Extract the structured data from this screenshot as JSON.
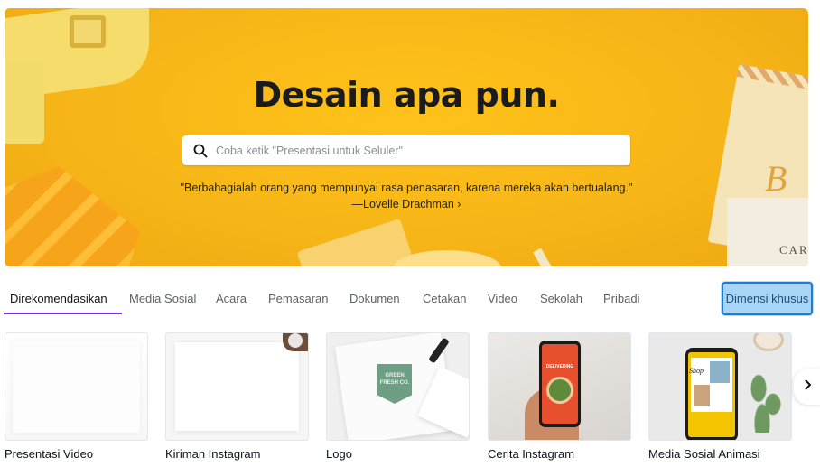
{
  "hero": {
    "title": "Desain apa pun.",
    "search_placeholder": "Coba ketik \"Presentasi untuk Seluler\"",
    "quote": "\"Berbahagialah orang yang mempunyai rasa penasaran, karena mereka akan bertualang.\"",
    "quote_author": "—Lovelle Drachman ›",
    "decoration_text": {
      "cart": "CART",
      "script": "B"
    }
  },
  "tabs": [
    {
      "label": "Direkomendasikan",
      "active": true
    },
    {
      "label": "Media Sosial"
    },
    {
      "label": "Acara"
    },
    {
      "label": "Pemasaran"
    },
    {
      "label": "Dokumen"
    },
    {
      "label": "Cetakan"
    },
    {
      "label": "Video"
    },
    {
      "label": "Sekolah"
    },
    {
      "label": "Pribadi"
    }
  ],
  "custom_size_button": "Dimensi khusus",
  "cards": [
    {
      "label": "Presentasi Video"
    },
    {
      "label": "Kiriman Instagram"
    },
    {
      "label": "Logo",
      "thumb_text": "GREEN FRESH CO."
    },
    {
      "label": "Cerita Instagram",
      "thumb_text": "DELIVERING"
    },
    {
      "label": "Media Sosial Animasi",
      "thumb_text": "Shop"
    }
  ],
  "icons": {
    "search": "search-icon",
    "next": "chevron-right-icon"
  },
  "colors": {
    "hero_bg": "#f7b618",
    "tab_active_underline": "#7d2ae8",
    "custom_button_bg": "#a6d5f6",
    "custom_button_border": "#1f7ad0"
  }
}
